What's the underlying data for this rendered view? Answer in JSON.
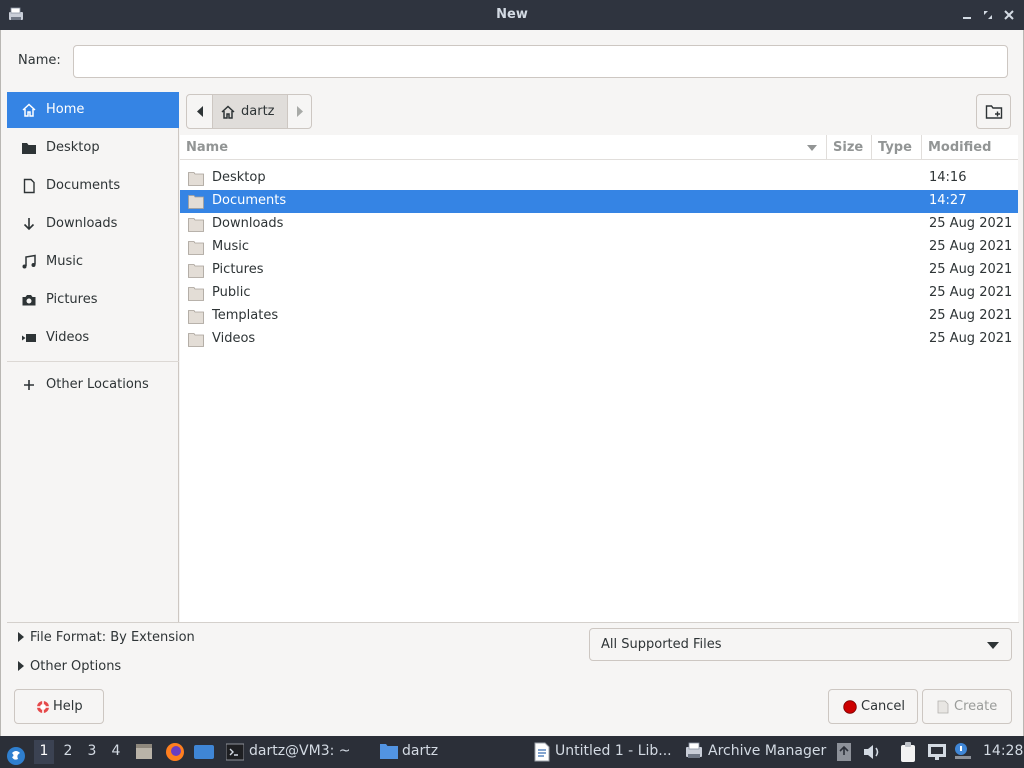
{
  "window": {
    "title": "New"
  },
  "name_field": {
    "label": "Name:",
    "value": "",
    "placeholder": ""
  },
  "sidebar": {
    "items": [
      {
        "label": "Home",
        "icon": "home-icon"
      },
      {
        "label": "Desktop",
        "icon": "folder-icon"
      },
      {
        "label": "Documents",
        "icon": "document-icon"
      },
      {
        "label": "Downloads",
        "icon": "download-icon"
      },
      {
        "label": "Music",
        "icon": "music-icon"
      },
      {
        "label": "Pictures",
        "icon": "camera-icon"
      },
      {
        "label": "Videos",
        "icon": "video-icon"
      },
      {
        "label": "Other Locations",
        "icon": "plus-icon"
      }
    ],
    "active_index": 0
  },
  "pathbar": {
    "current": "dartz"
  },
  "columns": {
    "name": "Name",
    "size": "Size",
    "type": "Type",
    "modified": "Modified"
  },
  "files": [
    {
      "name": "Desktop",
      "modified": "14:16"
    },
    {
      "name": "Documents",
      "modified": "14:27"
    },
    {
      "name": "Downloads",
      "modified": "25 Aug 2021"
    },
    {
      "name": "Music",
      "modified": "25 Aug 2021"
    },
    {
      "name": "Pictures",
      "modified": "25 Aug 2021"
    },
    {
      "name": "Public",
      "modified": "25 Aug 2021"
    },
    {
      "name": "Templates",
      "modified": "25 Aug 2021"
    },
    {
      "name": "Videos",
      "modified": "25 Aug 2021"
    }
  ],
  "selected_file_index": 1,
  "options": {
    "file_format": "File Format: By Extension",
    "other_options": "Other Options",
    "filter": "All Supported Files"
  },
  "buttons": {
    "help": "Help",
    "cancel": "Cancel",
    "create": "Create"
  },
  "taskbar": {
    "workspaces": [
      "1",
      "2",
      "3",
      "4"
    ],
    "active_workspace": "1",
    "tasks": [
      "dartz@VM3: ~",
      "dartz",
      "Untitled 1 - Lib...",
      "Archive Manager"
    ],
    "clock": "14:28"
  },
  "colors": {
    "accent": "#3584e4",
    "titlebar": "#2f343f",
    "panel": "#2b2f38"
  }
}
